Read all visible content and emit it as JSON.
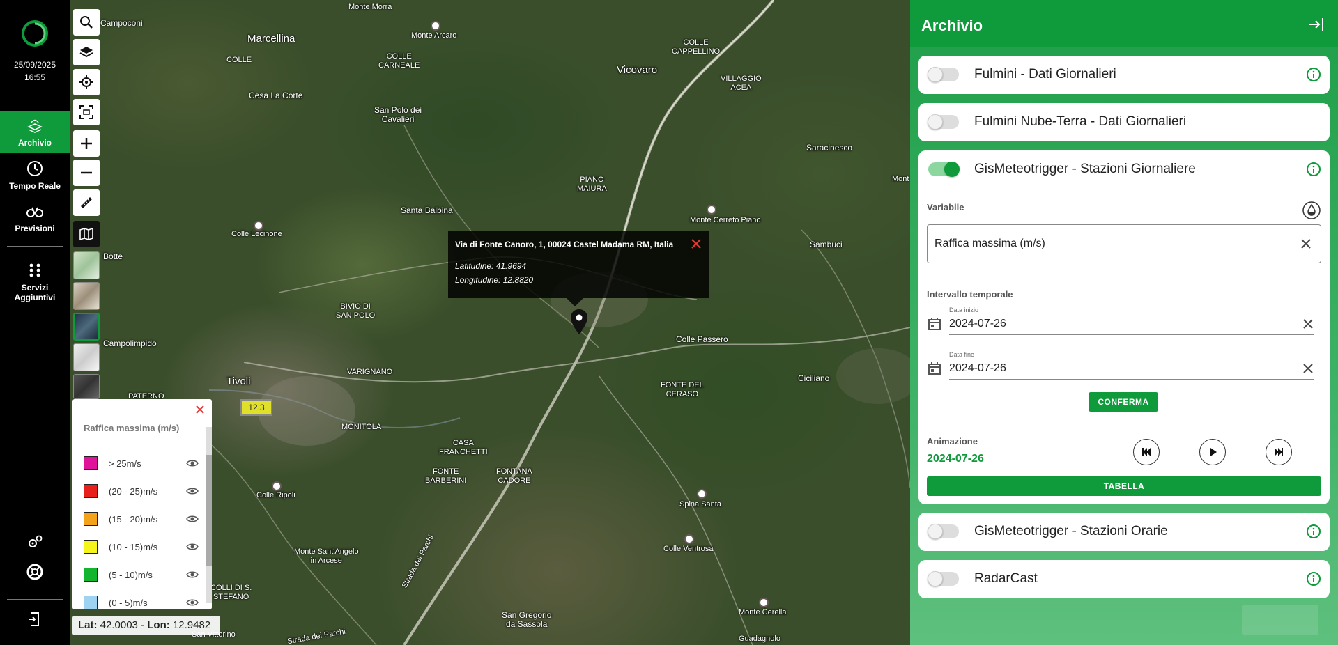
{
  "nav": {
    "date": "25/09/2025",
    "time": "16:55",
    "items": [
      {
        "label": "Archivio"
      },
      {
        "label": "Tempo Reale"
      },
      {
        "label": "Previsioni"
      },
      {
        "label": "Servizi Aggiuntivi"
      }
    ]
  },
  "map": {
    "places": [
      {
        "name": "Monte Morra"
      },
      {
        "name": "Campoconi"
      },
      {
        "name": "Marcellina"
      },
      {
        "name": "Monte Arcaro"
      },
      {
        "name": "COLLE"
      },
      {
        "name": "COLLE\nCARNEALE"
      },
      {
        "name": "Cesa La Corte"
      },
      {
        "name": "San Polo dei\nCavalieri"
      },
      {
        "name": "Vicovaro"
      },
      {
        "name": "COLLE\nCAPPELLINO"
      },
      {
        "name": "VILLAGGIO\nACEA"
      },
      {
        "name": "Saracinesco"
      },
      {
        "name": "Mont"
      },
      {
        "name": "PIANO\nMAIURA"
      },
      {
        "name": "Santa Balbina"
      },
      {
        "name": "Monte Cerreto Piano"
      },
      {
        "name": "Colle Lecinone"
      },
      {
        "name": "Sambuci"
      },
      {
        "name": "Botte"
      },
      {
        "name": "BIVIO DI\nSAN POLO"
      },
      {
        "name": "Campolimpido"
      },
      {
        "name": "Colle Passero"
      },
      {
        "name": "Tivoli"
      },
      {
        "name": "VARIGNANO"
      },
      {
        "name": "Ciciliano"
      },
      {
        "name": "FONTE DEL\nCERASO"
      },
      {
        "name": "PATERNO"
      },
      {
        "name": "MONITOLA"
      },
      {
        "name": "CASA\nFRANCHETTI"
      },
      {
        "name": "FONTE\nBARBERINI"
      },
      {
        "name": "FONTANA\nCADORE"
      },
      {
        "name": "Colle Ripoli"
      },
      {
        "name": "Spina Santa"
      },
      {
        "name": "Monte Sant'Angelo\nin Arcese"
      },
      {
        "name": "Colle Ventrosa"
      },
      {
        "name": "COLLI DI S.\nSTEFANO"
      },
      {
        "name": "Strada dei Parchi"
      },
      {
        "name": "Monte Cerella"
      },
      {
        "name": "San Gregorio\nda Sassola"
      },
      {
        "name": "Guadagnolo"
      },
      {
        "name": "San Vittorino"
      },
      {
        "name": "Strada dei Parchi"
      }
    ],
    "popup": {
      "address": "Via di Fonte Canoro, 1, 00024 Castel Madama RM, Italia",
      "lat_text": "Latitudine: 41.9694",
      "lon_text": "Longitudine: 12.8820"
    },
    "marker_value": "12.3",
    "latlon": {
      "lat_label": "Lat:",
      "lat": "42.0003",
      "sep": " - ",
      "lon_label": "Lon:",
      "lon": "12.9482"
    }
  },
  "legend": {
    "title": "Raffica massima (m/s)",
    "rows": [
      {
        "label": "> 25m/s",
        "color": "#e0139b"
      },
      {
        "label": "(20 - 25)m/s",
        "color": "#e8201c"
      },
      {
        "label": "(15 - 20)m/s",
        "color": "#f5a21b"
      },
      {
        "label": "(10 - 15)m/s",
        "color": "#f5f51b"
      },
      {
        "label": "(5 - 10)m/s",
        "color": "#13b52e"
      },
      {
        "label": "(0 - 5)m/s",
        "color": "#9fd3f2"
      }
    ]
  },
  "panel": {
    "title": "Archivio",
    "layers": [
      {
        "title": "Fulmini - Dati Giornalieri",
        "enabled": false
      },
      {
        "title": "Fulmini Nube-Terra - Dati Giornalieri",
        "enabled": false
      },
      {
        "title": "GisMeteotrigger - Stazioni Giornaliere",
        "enabled": true
      },
      {
        "title": "GisMeteotrigger - Stazioni Orarie",
        "enabled": false
      },
      {
        "title": "RadarCast",
        "enabled": false
      }
    ],
    "expanded": {
      "variable_label": "Variabile",
      "variable_value": "Raffica massima (m/s)",
      "interval_label": "Intervallo temporale",
      "start_label": "Data inizio",
      "start_value": "2024-07-26",
      "end_label": "Data fine",
      "end_value": "2024-07-26",
      "confirm_label": "CONFERMA",
      "animation_label": "Animazione",
      "animation_date": "2024-07-26",
      "table_label": "TABELLA"
    }
  },
  "colors": {
    "accent": "#0f9a3b"
  }
}
